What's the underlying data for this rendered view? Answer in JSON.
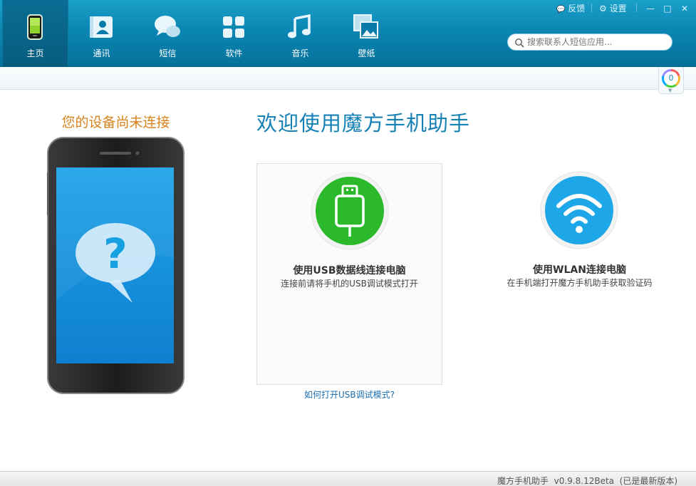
{
  "nav": {
    "items": [
      {
        "label": "主页",
        "icon": "phone-icon",
        "active": true
      },
      {
        "label": "通讯",
        "icon": "contacts-icon"
      },
      {
        "label": "短信",
        "icon": "sms-icon"
      },
      {
        "label": "软件",
        "icon": "apps-icon"
      },
      {
        "label": "音乐",
        "icon": "music-icon"
      },
      {
        "label": "壁纸",
        "icon": "wallpaper-icon"
      }
    ]
  },
  "window": {
    "feedback_label": "反馈",
    "settings_label": "设置",
    "minimize_glyph": "—",
    "maximize_glyph": "□",
    "close_glyph": "✕"
  },
  "search": {
    "placeholder": "搜索联系人短信应用..."
  },
  "notification": {
    "count": "0"
  },
  "device": {
    "status_text": "您的设备尚未连接"
  },
  "welcome": {
    "title": "欢迎使用魔方手机助手"
  },
  "usb": {
    "title": "使用USB数据线连接电脑",
    "description": "连接前请将手机的USB调试模式打开",
    "help_link": "如何打开USB调试模式?"
  },
  "wlan": {
    "title": "使用WLAN连接电脑",
    "description": "在手机端打开魔方手机助手获取验证码"
  },
  "footer": {
    "version_text": "魔方手机助手  v0.9.8.12Beta  (已是最新版本)"
  },
  "colors": {
    "header": "#0b86b3",
    "accent_orange": "#d8821c",
    "accent_blue": "#1581b4",
    "usb_green": "#2bb92b",
    "wlan_blue": "#1ea7e8"
  }
}
